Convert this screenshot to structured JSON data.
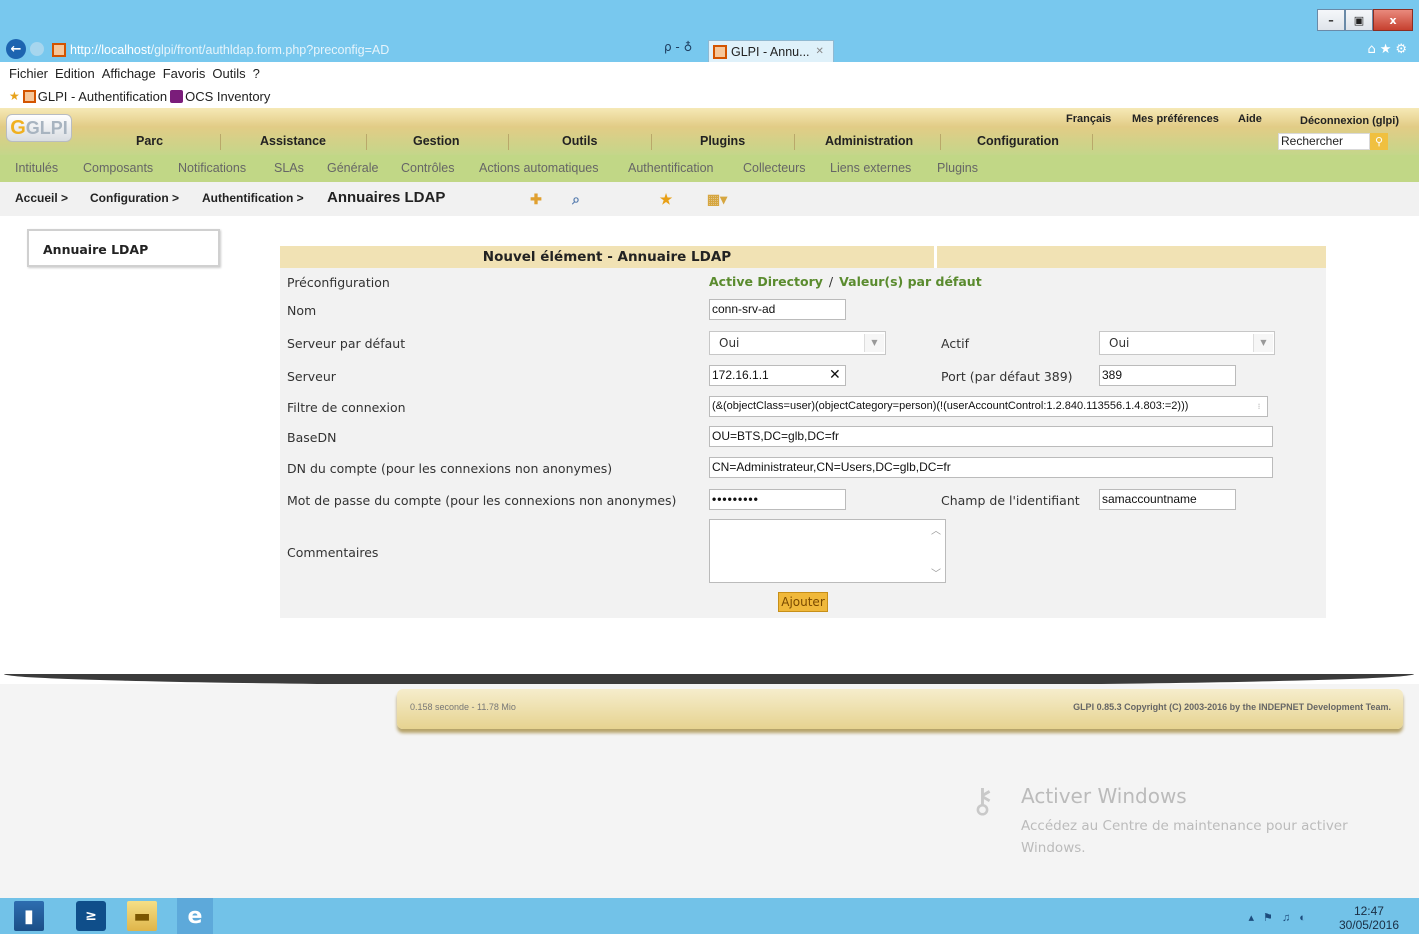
{
  "browser": {
    "window_controls": {
      "minimize": "–",
      "maximize": "▣",
      "close": "x"
    },
    "url_host": "http://localhost",
    "url_path": "/glpi/front/authldap.form.php?preconfig=AD",
    "address_tools": "ρ - ♁",
    "tab_title": "GLPI - Annu...",
    "menu": [
      "Fichier",
      "Edition",
      "Affichage",
      "Favoris",
      "Outils",
      "?"
    ],
    "favorites": [
      "GLPI - Authentification",
      "OCS Inventory"
    ]
  },
  "glpi": {
    "logo": "GLPI",
    "pref_links": {
      "language": "Français",
      "preferences": "Mes préférences",
      "help": "Aide",
      "logout": "Déconnexion (glpi)"
    },
    "main_menu": [
      "Parc",
      "Assistance",
      "Gestion",
      "Outils",
      "Plugins",
      "Administration",
      "Configuration"
    ],
    "search_placeholder": "Rechercher",
    "sub_menu": [
      "Intitulés",
      "Composants",
      "Notifications",
      "SLAs",
      "Générale",
      "Contrôles",
      "Actions automatiques",
      "Authentification",
      "Collecteurs",
      "Liens externes",
      "Plugins"
    ],
    "breadcrumb": [
      "Accueil >",
      "Configuration >",
      "Authentification >"
    ],
    "breadcrumb_current": "Annuaires LDAP"
  },
  "side_tab": "Annuaire LDAP",
  "form": {
    "title": "Nouvel élément - Annuaire LDAP",
    "preconfig_label": "Préconfiguration",
    "preconfig_ad": "Active Directory",
    "preconfig_sep": "/",
    "preconfig_default": "Valeur(s) par défaut",
    "name_label": "Nom",
    "name_value": "conn-srv-ad",
    "default_server_label": "Serveur par défaut",
    "default_server_value": "Oui",
    "active_label": "Actif",
    "active_value": "Oui",
    "server_label": "Serveur",
    "server_value": "172.16.1.1",
    "port_label": "Port (par défaut 389)",
    "port_value": "389",
    "filter_label": "Filtre de connexion",
    "filter_value": "(&(objectClass=user)(objectCategory=person)(!(userAccountControl:1.2.840.113556.1.4.803:=2)))",
    "basedn_label": "BaseDN",
    "basedn_value": "OU=BTS,DC=glb,DC=fr",
    "dn_label": "DN du compte (pour les connexions non anonymes)",
    "dn_value": "CN=Administrateur,CN=Users,DC=glb,DC=fr",
    "password_label": "Mot de passe du compte (pour les connexions non anonymes)",
    "password_value": "•••••••••",
    "identifier_label": "Champ de l'identifiant",
    "identifier_value": "samaccountname",
    "comments_label": "Commentaires",
    "submit_label": "Ajouter"
  },
  "footer": {
    "timing": "0.158 seconde - 11.78 Mio",
    "copyright": "GLPI 0.85.3 Copyright (C) 2003-2016 by the INDEPNET Development Team."
  },
  "watermark": {
    "title": "Activer Windows",
    "subtitle": "Accédez au Centre de maintenance pour activer Windows."
  },
  "taskbar": {
    "tray_icons": "▴ ⚑ ♫ ◐",
    "time": "12:47",
    "date": "30/05/2016"
  },
  "colors": {
    "titlebar": "#78c8ee",
    "submenu": "#c1d786",
    "form_header": "#f1e2b4",
    "link_green": "#5a8b2e",
    "button": "#f0b83a"
  }
}
